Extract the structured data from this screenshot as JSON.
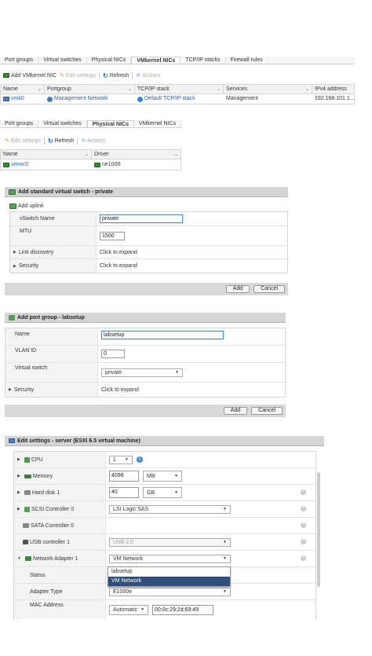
{
  "vmk_panel": {
    "tabs": [
      "Port groups",
      "Virtual switches",
      "Physical NICs",
      "VMkernel NICs",
      "TCP/IP stacks",
      "Firewall rules"
    ],
    "active_tab": 3,
    "toolbar": {
      "add": "Add VMkernel NIC",
      "edit": "Edit settings",
      "refresh": "Refresh",
      "actions": "Actions"
    },
    "columns": [
      "Name",
      "Portgroup",
      "TCP/IP stack",
      "Services",
      "IPv4 address"
    ],
    "rows": [
      {
        "name": "vmk0",
        "portgroup": "Management Network",
        "stack": "Default TCP/IP stack",
        "services": "Management",
        "ipv4": "192.168.101.1..."
      }
    ]
  },
  "pnic_panel": {
    "tabs": [
      "Port groups",
      "Virtual switches",
      "Physical NICs",
      "VMkernel NICs"
    ],
    "active_tab": 2,
    "toolbar": {
      "edit": "Edit settings",
      "refresh": "Refresh",
      "actions": "Actions"
    },
    "columns": [
      "Name",
      "Driver"
    ],
    "rows": [
      {
        "name": "vmnic0",
        "driver": "ne1000"
      }
    ]
  },
  "vswitch_dialog": {
    "title": "Add standard virtual switch - private",
    "add_uplink": "Add uplink",
    "fields": {
      "name_label": "vSwitch Name",
      "name_value": "private",
      "mtu_label": "MTU",
      "mtu_value": "1500",
      "link_label": "Link discovery",
      "link_value": "Click to expand",
      "security_label": "Security",
      "security_value": "Click to expand"
    },
    "add_button": "Add",
    "cancel_button": "Cancel"
  },
  "portgroup_dialog": {
    "title": "Add port group - labsetup",
    "fields": {
      "name_label": "Name",
      "name_value": "labsetup",
      "vlan_label": "VLAN ID",
      "vlan_value": "0",
      "vswitch_label": "Virtual switch",
      "vswitch_value": "private",
      "security_label": "Security",
      "security_value": "Click to expand"
    },
    "add_button": "Add",
    "cancel_button": "Cancel"
  },
  "edit_dialog": {
    "title": "Edit settings - server (ESXi 6.5 virtual machine)",
    "cpu": {
      "label": "CPU",
      "value": "1"
    },
    "memory": {
      "label": "Memory",
      "value": "4096",
      "unit": "MB"
    },
    "disk": {
      "label": "Hard disk 1",
      "value": "40",
      "unit": "GB"
    },
    "scsi": {
      "label": "SCSI Controller 0",
      "value": "LSI Logic SAS"
    },
    "sata": {
      "label": "SATA Controller 0"
    },
    "usb": {
      "label": "USB controller 1",
      "value": "USB 2.0"
    },
    "nic": {
      "label": "Network Adapter 1",
      "value": "VM Network"
    },
    "nic_options": [
      "labsetup",
      "VM Network"
    ],
    "nic_selected": 1,
    "status": {
      "label": "Status"
    },
    "adapter": {
      "label": "Adapter Type",
      "value": "E1000e"
    },
    "mac": {
      "label": "MAC Address",
      "mode": "Automatic",
      "value": "00:0c:29:2d:69:49"
    }
  }
}
